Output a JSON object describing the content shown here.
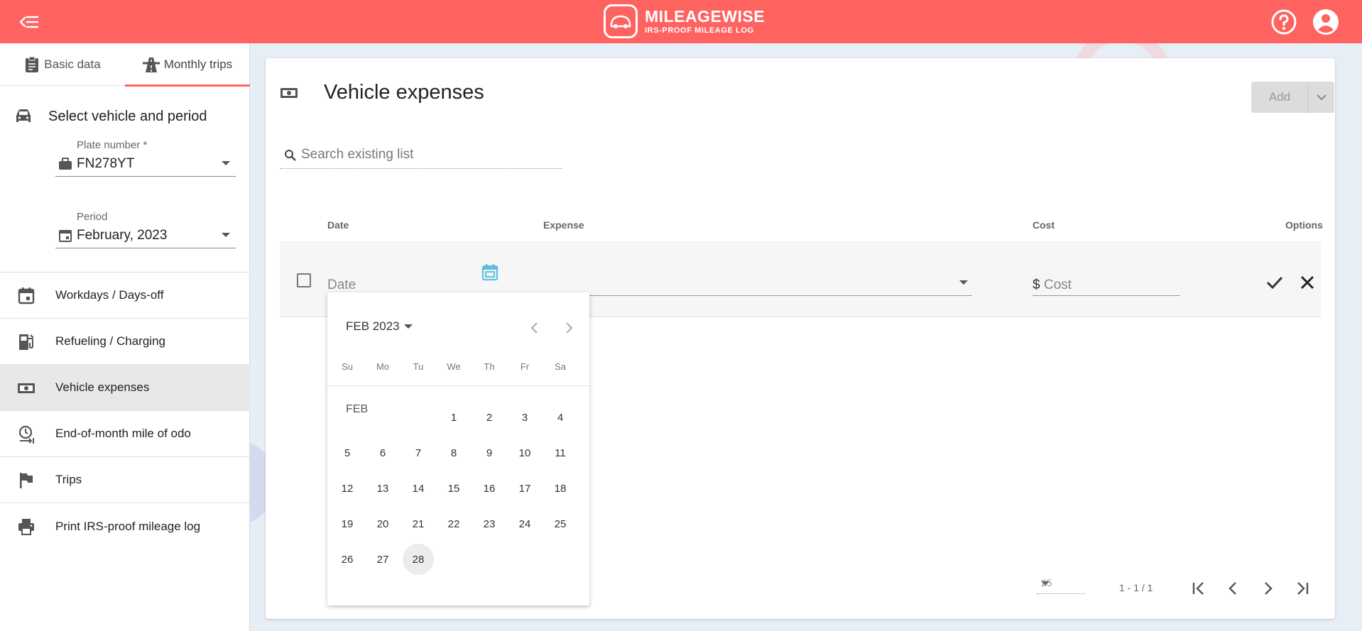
{
  "header": {
    "logo_name": "MILEAGEWISE",
    "logo_tagline": "IRS-PROOF MILEAGE LOG",
    "accent": "#ff6360"
  },
  "sidebar": {
    "tabs": [
      {
        "label": "Basic data",
        "icon": "clipboard-icon"
      },
      {
        "label": "Monthly trips",
        "icon": "road-icon",
        "active": true
      }
    ],
    "section_title": "Select vehicle and period",
    "plate": {
      "label": "Plate number *",
      "value": "FN278YT"
    },
    "period": {
      "label": "Period",
      "value": "February, 2023"
    },
    "items": [
      {
        "label": "Workdays / Days-off",
        "icon": "calendar-icon"
      },
      {
        "label": "Refueling / Charging",
        "icon": "fuel-pump-icon"
      },
      {
        "label": "Vehicle expenses",
        "icon": "money-icon",
        "active": true
      },
      {
        "label": "End-of-month mile of odo",
        "icon": "clock-arrow-icon"
      },
      {
        "label": "Trips",
        "icon": "flag-icon"
      },
      {
        "label": "Print IRS-proof mileage log",
        "icon": "printer-icon"
      }
    ]
  },
  "main": {
    "title": "Vehicle expenses",
    "add_label": "Add",
    "search_placeholder": "Search existing list",
    "columns": {
      "date": "Date",
      "expense": "Expense",
      "cost": "Cost",
      "options": "Options"
    },
    "row": {
      "date_placeholder": "Date",
      "currency": "$",
      "cost_placeholder": "Cost"
    },
    "pagination": {
      "page_size": "25",
      "range": "1 - 1 / 1"
    }
  },
  "calendar": {
    "header": "FEB 2023",
    "weekdays": [
      "Su",
      "Mo",
      "Tu",
      "We",
      "Th",
      "Fr",
      "Sa"
    ],
    "month_label": "FEB",
    "first_weekday": 3,
    "days_in_month": 28,
    "today": 28
  }
}
